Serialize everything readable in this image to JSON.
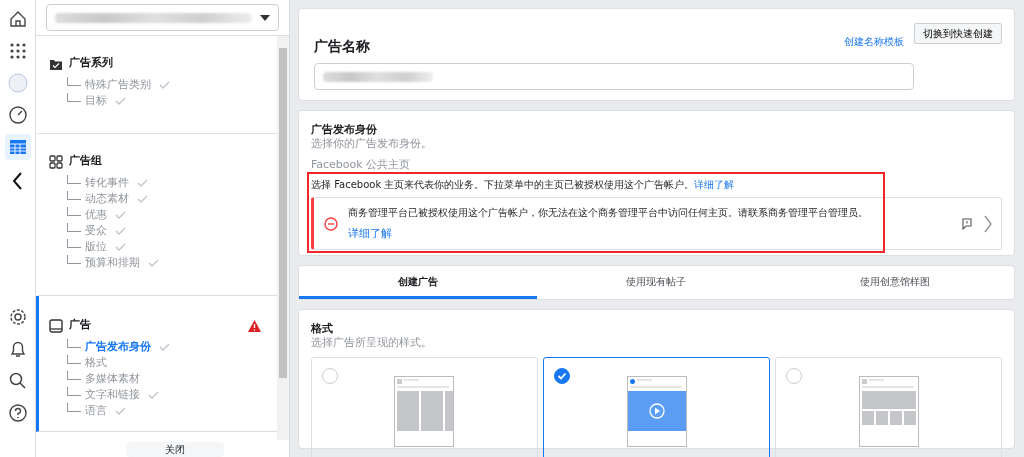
{
  "rail": {
    "items": [
      {
        "kind": "home",
        "selected": false
      },
      {
        "kind": "apps",
        "selected": false
      },
      {
        "kind": "avatar",
        "selected": false
      },
      {
        "kind": "gauge",
        "selected": false
      },
      {
        "kind": "table",
        "selected": true
      },
      {
        "kind": "collapse",
        "selected": false
      },
      {
        "kind": "gear",
        "selected": false
      },
      {
        "kind": "bell",
        "selected": false
      },
      {
        "kind": "search",
        "selected": false
      },
      {
        "kind": "help",
        "selected": false
      }
    ]
  },
  "sidebar": {
    "sections": [
      {
        "kind": "campaign",
        "title": "广告系列",
        "selected": false,
        "warning": false,
        "items": [
          {
            "label": "特殊广告类别",
            "checked": true,
            "selected": false
          },
          {
            "label": "目标",
            "checked": true,
            "selected": false
          }
        ]
      },
      {
        "kind": "adset",
        "title": "广告组",
        "selected": false,
        "warning": false,
        "items": [
          {
            "label": "转化事件",
            "checked": true,
            "selected": false
          },
          {
            "label": "动态素材",
            "checked": true,
            "selected": false
          },
          {
            "label": "优惠",
            "checked": true,
            "selected": false
          },
          {
            "label": "受众",
            "checked": true,
            "selected": false
          },
          {
            "label": "版位",
            "checked": true,
            "selected": false
          },
          {
            "label": "预算和排期",
            "checked": true,
            "selected": false
          }
        ]
      },
      {
        "kind": "ad",
        "title": "广告",
        "selected": true,
        "warning": true,
        "items": [
          {
            "label": "广告发布身份",
            "checked": true,
            "selected": true
          },
          {
            "label": "格式",
            "checked": false,
            "selected": false
          },
          {
            "label": "多媒体素材",
            "checked": false,
            "selected": false
          },
          {
            "label": "文字和链接",
            "checked": true,
            "selected": false
          },
          {
            "label": "语言",
            "checked": true,
            "selected": false
          }
        ]
      }
    ],
    "close_button": "关闭"
  },
  "ad_name": {
    "title": "广告名称",
    "template_link": "创建名称模板",
    "switch_button": "切换到快速创建"
  },
  "identity": {
    "title": "广告发布身份",
    "subtitle": "选择你的广告发布身份。",
    "page_label": "Facebook 公共主页",
    "description": "选择 Facebook 主页来代表你的业务。下拉菜单中的主页已被授权使用这个广告帐户。",
    "description_link": "详细了解",
    "error": {
      "message": "商务管理平台已被授权使用这个广告帐户，你无法在这个商务管理平台中访问任何主页。请联系商务管理平台管理员。",
      "link": "详细了解"
    }
  },
  "tabs": [
    {
      "label": "创建广告",
      "selected": true
    },
    {
      "label": "使用现有帖子",
      "selected": false
    },
    {
      "label": "使用创意馆样图",
      "selected": false
    }
  ],
  "format": {
    "title": "格式",
    "subtitle": "选择广告所呈现的样式。",
    "options": [
      {
        "kind": "carousel",
        "selected": false
      },
      {
        "kind": "video",
        "selected": true
      },
      {
        "kind": "collection",
        "selected": false
      }
    ]
  }
}
